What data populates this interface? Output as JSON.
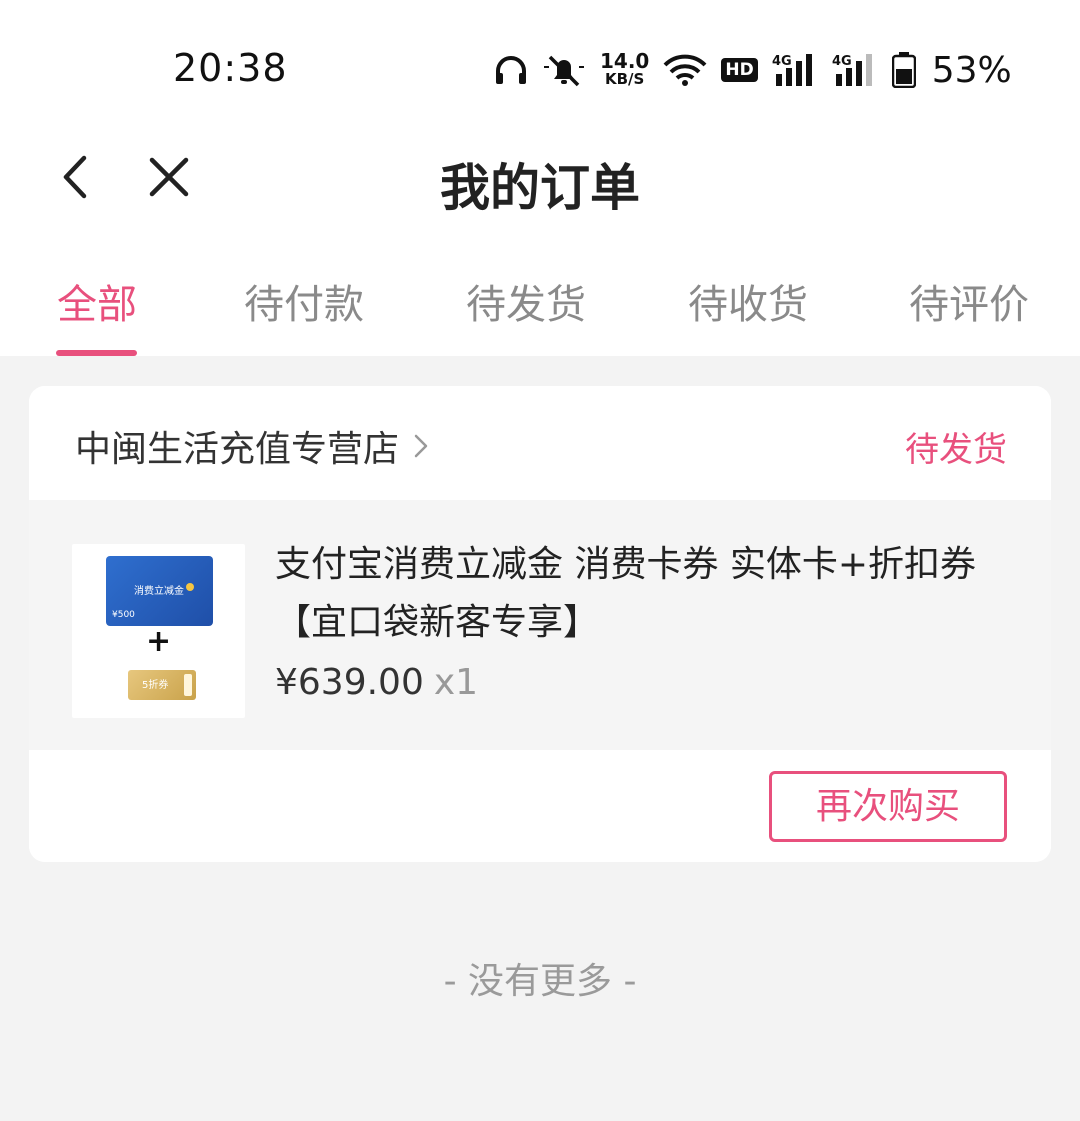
{
  "status_bar": {
    "time": "20:38",
    "speed_value": "14.0",
    "speed_unit": "KB/S",
    "hd_badge": "HD",
    "battery_percent": "53%",
    "icons": [
      "headphones-icon",
      "bell-muted-icon",
      "wifi-icon",
      "signal-4g-icon",
      "signal-4g-icon",
      "battery-icon"
    ]
  },
  "nav": {
    "title": "我的订单",
    "back_icon": "chevron-left-icon",
    "close_icon": "close-icon"
  },
  "tabs": [
    {
      "label": "全部",
      "active": true
    },
    {
      "label": "待付款",
      "active": false
    },
    {
      "label": "待发货",
      "active": false
    },
    {
      "label": "待收货",
      "active": false
    },
    {
      "label": "待评价",
      "active": false
    }
  ],
  "order": {
    "store_name": "中闽生活充值专营店",
    "status": "待发货",
    "product": {
      "title": "支付宝消费立减金 消费卡券 实体卡+折扣券【宜口袋新客专享】",
      "price": "¥639.00",
      "quantity": "x1",
      "thumbnail": {
        "card_title": "消费立减金",
        "card_amount": "¥500",
        "plus": "+",
        "coupon_label": "5折券"
      }
    },
    "rebuy_label": "再次购买"
  },
  "footer_text": "- 没有更多 -",
  "colors": {
    "accent": "#e8507d",
    "background": "#f3f3f3",
    "tab_inactive": "#8a8a8a"
  }
}
